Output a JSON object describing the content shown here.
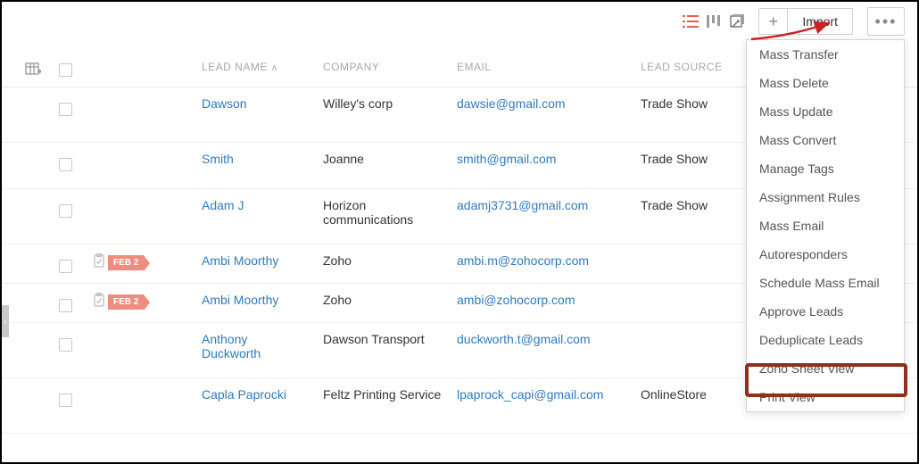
{
  "toolbar": {
    "list_icon": "list-icon",
    "kanban_icon": "kanban-icon",
    "canvas_icon": "canvas-icon",
    "plus_label": "+",
    "import_label": "Import",
    "more_label": "•••"
  },
  "columns": {
    "lead": "LEAD NAME",
    "company": "COMPANY",
    "email": "EMAIL",
    "source": "LEAD SOURCE"
  },
  "rows": [
    {
      "name": "Dawson",
      "company": "Willey's corp",
      "email": "dawsie@gmail.com",
      "source": "Trade Show",
      "tag": null
    },
    {
      "name": "Smith",
      "company": "Joanne",
      "email": "smith@gmail.com",
      "source": "Trade Show",
      "tag": null
    },
    {
      "name": "Adam J",
      "company": "Horizon communications",
      "email": "adamj3731@gmail.com",
      "source": "Trade Show",
      "tag": null
    },
    {
      "name": "Ambi Moorthy",
      "company": "Zoho",
      "email": "ambi.m@zohocorp.com",
      "source": "",
      "tag": "FEB 2"
    },
    {
      "name": "Ambi Moorthy",
      "company": "Zoho",
      "email": "ambi@zohocorp.com",
      "source": "",
      "tag": "FEB 2"
    },
    {
      "name": "Anthony Duckworth",
      "company": "Dawson Transport",
      "email": "duckworth.t@gmail.com",
      "source": "",
      "tag": null
    },
    {
      "name": "Capla Paprocki",
      "company": "Feltz Printing Service",
      "email": "lpaprock_capi@gmail.com",
      "source": "OnlineStore",
      "tag": null
    }
  ],
  "menu": {
    "items": [
      "Mass Transfer",
      "Mass Delete",
      "Mass Update",
      "Mass Convert",
      "Manage Tags",
      "Assignment Rules",
      "Mass Email",
      "Autoresponders",
      "Schedule Mass Email",
      "Approve Leads",
      "Deduplicate Leads",
      "Zoho Sheet View",
      "Print View"
    ]
  }
}
